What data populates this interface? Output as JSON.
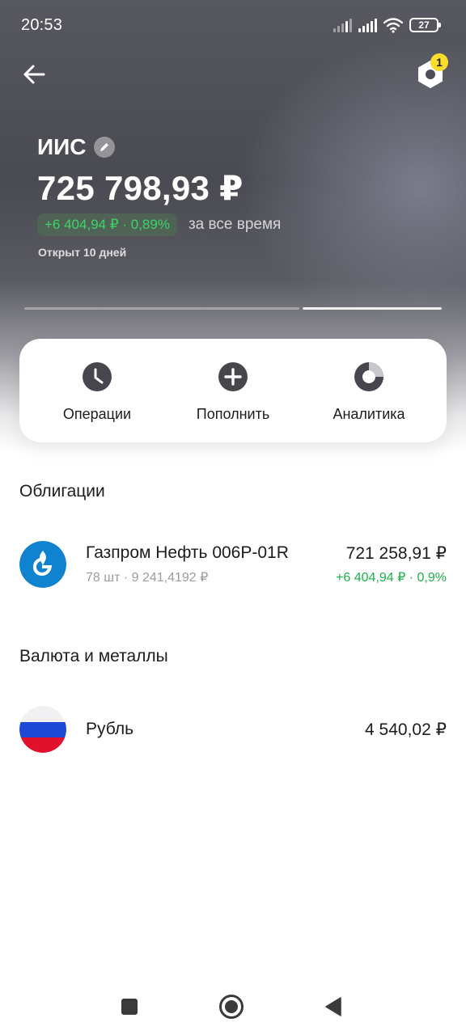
{
  "status_bar": {
    "time": "20:53",
    "battery": "27",
    "icons": [
      "signal-1-icon",
      "signal-2-icon",
      "wifi-icon",
      "battery-icon"
    ]
  },
  "header": {
    "back_icon": "arrow-left-icon",
    "settings_icon": "settings-nut-icon",
    "settings_badge": "1",
    "badge_color": "#ffdd2d"
  },
  "account": {
    "name": "ИИС",
    "balance": "725 798,93 ₽",
    "change": "+6 404,94 ₽ · 0,89%",
    "change_period": "за все время",
    "opened": "Открыт 10 дней",
    "positive_color": "#3cd566"
  },
  "actions": [
    {
      "label": "Операции",
      "icon": "clock-icon"
    },
    {
      "label": "Пополнить",
      "icon": "plus-circle-icon"
    },
    {
      "label": "Аналитика",
      "icon": "donut-chart-icon"
    }
  ],
  "sections": {
    "bonds": {
      "title": "Облигации",
      "items": [
        {
          "name": "Газпром Нефть 006Р-01R",
          "sub": "78 шт · 9 241,4192 ₽",
          "value": "721 258,91 ₽",
          "change": "+6 404,94 ₽ · 0,9%",
          "logo": "gazprom-neft-logo"
        }
      ]
    },
    "currency": {
      "title": "Валюта и металлы",
      "items": [
        {
          "name": "Рубль",
          "value": "4 540,02 ₽",
          "logo": "russian-flag-icon"
        }
      ]
    }
  },
  "navbar": {
    "icons": [
      "recents-square-icon",
      "home-circle-icon",
      "back-triangle-icon"
    ]
  }
}
